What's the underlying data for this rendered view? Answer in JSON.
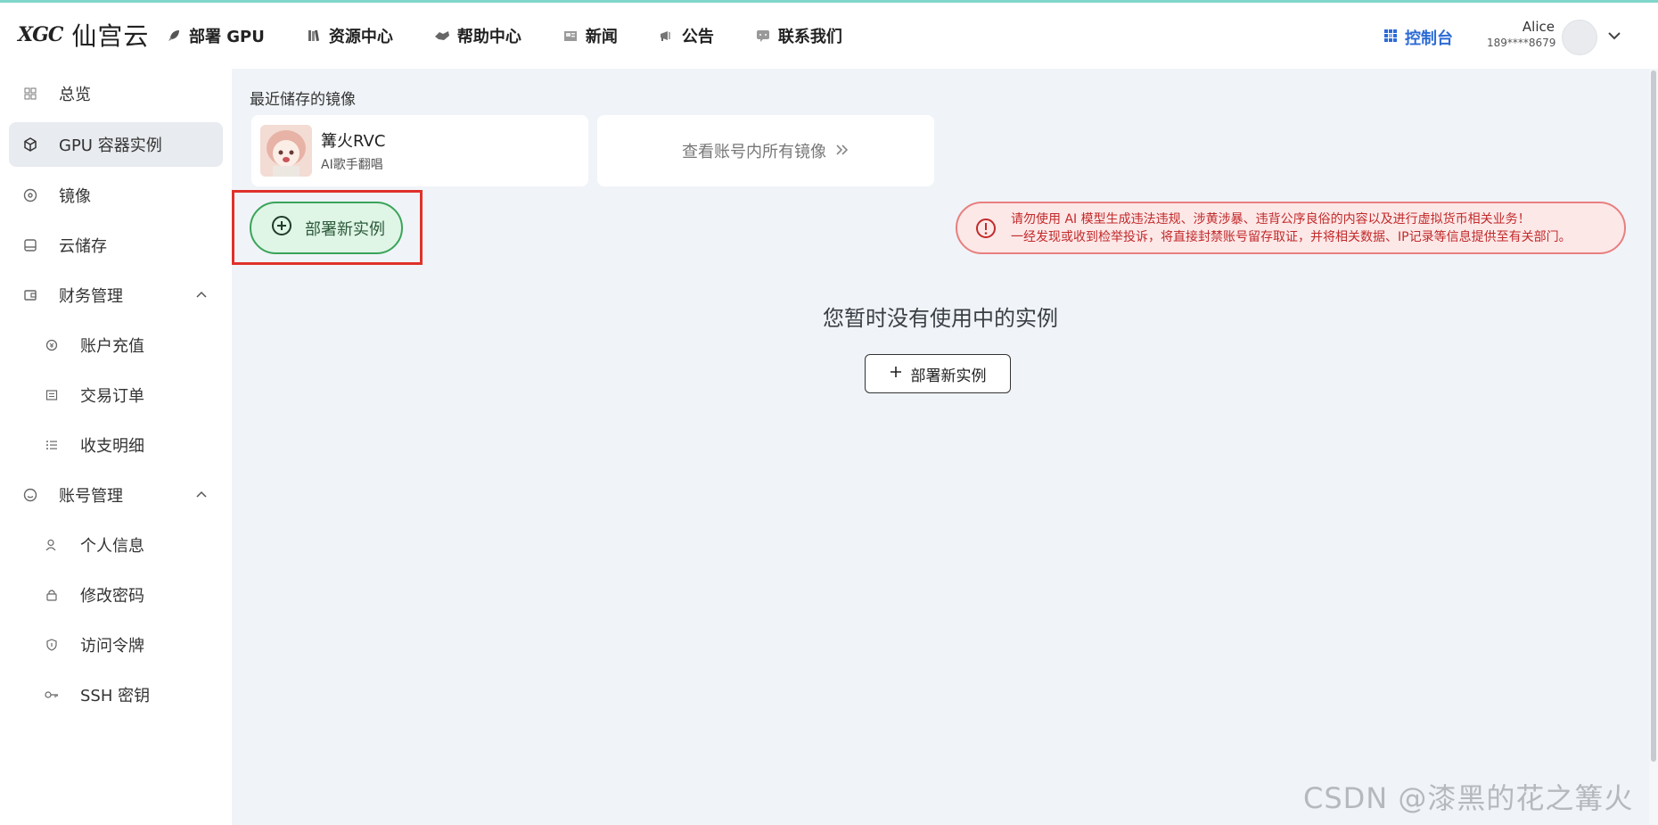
{
  "header": {
    "logo_mark": "XGC",
    "logo_text": "仙宫云",
    "nav": [
      {
        "label": "部署 GPU",
        "icon": "rocket-icon"
      },
      {
        "label": "资源中心",
        "icon": "books-icon"
      },
      {
        "label": "帮助中心",
        "icon": "handshake-icon"
      },
      {
        "label": "新闻",
        "icon": "newspaper-icon"
      },
      {
        "label": "公告",
        "icon": "megaphone-icon"
      },
      {
        "label": "联系我们",
        "icon": "chat-icon"
      }
    ],
    "console_label": "控制台",
    "user_name": "Alice",
    "user_phone": "189****8679"
  },
  "sidebar": {
    "items": [
      {
        "label": "总览",
        "icon": "grid-icon"
      },
      {
        "label": "GPU 容器实例",
        "icon": "cube-icon"
      },
      {
        "label": "镜像",
        "icon": "disc-icon"
      },
      {
        "label": "云储存",
        "icon": "drive-icon"
      },
      {
        "label": "财务管理",
        "icon": "wallet-icon"
      },
      {
        "label": "账户充值",
        "icon": "coin-icon"
      },
      {
        "label": "交易订单",
        "icon": "receipt-icon"
      },
      {
        "label": "收支明细",
        "icon": "list-icon"
      },
      {
        "label": "账号管理",
        "icon": "smile-icon"
      },
      {
        "label": "个人信息",
        "icon": "user-icon"
      },
      {
        "label": "修改密码",
        "icon": "lock-icon"
      },
      {
        "label": "访问令牌",
        "icon": "shield-icon"
      },
      {
        "label": "SSH 密钥",
        "icon": "key-icon"
      }
    ]
  },
  "main": {
    "recent_images_title": "最近储存的镜像",
    "image_card": {
      "name": "篝火RVC",
      "desc": "AI歌手翻唱"
    },
    "view_all_label": "查看账号内所有镜像",
    "deploy_pill_label": "部署新实例",
    "warning_line1": "请勿使用 AI 模型生成违法违规、涉黄涉暴、违背公序良俗的内容以及进行虚拟货币相关业务！",
    "warning_line2": "一经发现或收到检举投诉，将直接封禁账号留存取证，并将相关数据、IP记录等信息提供至有关部门。",
    "empty_title": "您暂时没有使用中的实例",
    "deploy_button_label": "部署新实例"
  },
  "watermark": "CSDN @漆黑的花之篝火",
  "colors": {
    "accent": "#2c6bd6",
    "success": "#3aa45a",
    "danger": "#c12a2a",
    "highlight": "#e0312b"
  }
}
